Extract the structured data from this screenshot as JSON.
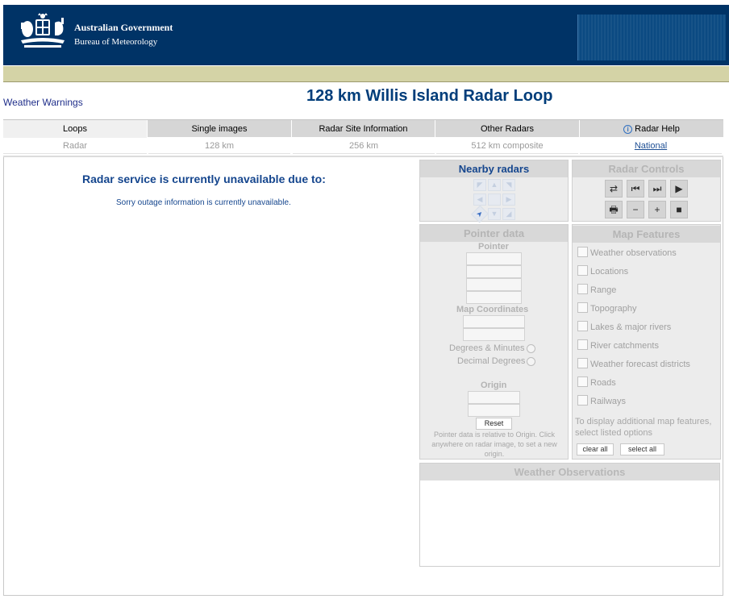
{
  "header": {
    "agency_line1": "Australian Government",
    "agency_line2": "Bureau of Meteorology"
  },
  "warnings_link": "Weather Warnings",
  "page_title": "128 km Willis Island Radar Loop",
  "tabs": [
    {
      "label": "Loops",
      "active": true
    },
    {
      "label": "Single images",
      "active": false
    },
    {
      "label": "Radar Site Information",
      "active": false
    },
    {
      "label": "Other Radars",
      "active": false
    },
    {
      "label": "Radar Help",
      "active": false,
      "icon": "info-icon"
    }
  ],
  "subtabs": [
    {
      "label": "Radar"
    },
    {
      "label": "128 km"
    },
    {
      "label": "256 km"
    },
    {
      "label": "512 km composite"
    },
    {
      "label": "National"
    }
  ],
  "status": {
    "title": "Radar service is currently unavailable due to:",
    "message": "Sorry outage information is currently unavailable."
  },
  "nearby": {
    "title": "Nearby radars",
    "arrows": [
      {
        "icon": "northwest-arrow-icon",
        "glyph": "◤"
      },
      {
        "icon": "north-arrow-icon",
        "glyph": "▲"
      },
      {
        "icon": "northeast-arrow-icon",
        "glyph": "◥"
      },
      {
        "icon": "west-arrow-icon",
        "glyph": "◀"
      },
      {
        "icon": "center-icon",
        "glyph": ""
      },
      {
        "icon": "east-arrow-icon",
        "glyph": "▶"
      },
      {
        "icon": "southwest-arrow-icon",
        "glyph": "➤"
      },
      {
        "icon": "south-arrow-icon",
        "glyph": "▼"
      },
      {
        "icon": "southeast-arrow-icon",
        "glyph": "◢"
      }
    ]
  },
  "controls": {
    "title": "Radar Controls",
    "buttons": [
      {
        "icon": "toggle-direction-icon",
        "glyph": "⇄"
      },
      {
        "icon": "first-frame-icon",
        "glyph": "⏮"
      },
      {
        "icon": "next-frame-icon",
        "glyph": "⏭"
      },
      {
        "icon": "play-icon",
        "glyph": "▶"
      },
      {
        "icon": "print-icon",
        "glyph": "🖶"
      },
      {
        "icon": "slower-icon",
        "glyph": "−"
      },
      {
        "icon": "faster-icon",
        "glyph": "+"
      },
      {
        "icon": "stop-icon",
        "glyph": "■"
      }
    ],
    "colors": {
      "button_bg": "#d4d4d4",
      "glyph": "#2b2b2b"
    }
  },
  "pointer": {
    "title": "Pointer data",
    "pointer_label": "Pointer",
    "map_coordinates_label": "Map Coordinates",
    "degrees_minutes_label": "Degrees & Minutes",
    "decimal_degrees_label": "Decimal Degrees",
    "origin_label": "Origin",
    "reset_label": "Reset",
    "note": "Pointer data is relative to Origin. Click anywhere on radar image, to set a new origin."
  },
  "map_features": {
    "title": "Map Features",
    "items": [
      "Weather observations",
      "Locations",
      "Range",
      "Topography",
      "Lakes & major rivers",
      "River catchments",
      "Weather forecast districts",
      "Roads",
      "Railways"
    ],
    "help": "To display additional map features, select listed options",
    "clear_all": "clear all",
    "select_all": "select all"
  },
  "observations": {
    "title": "Weather Observations"
  },
  "colors": {
    "header_bg": "#003366",
    "khaki_band": "#d4d3a6",
    "title_blue": "#003d7a",
    "link_blue": "#1f2e8a"
  }
}
